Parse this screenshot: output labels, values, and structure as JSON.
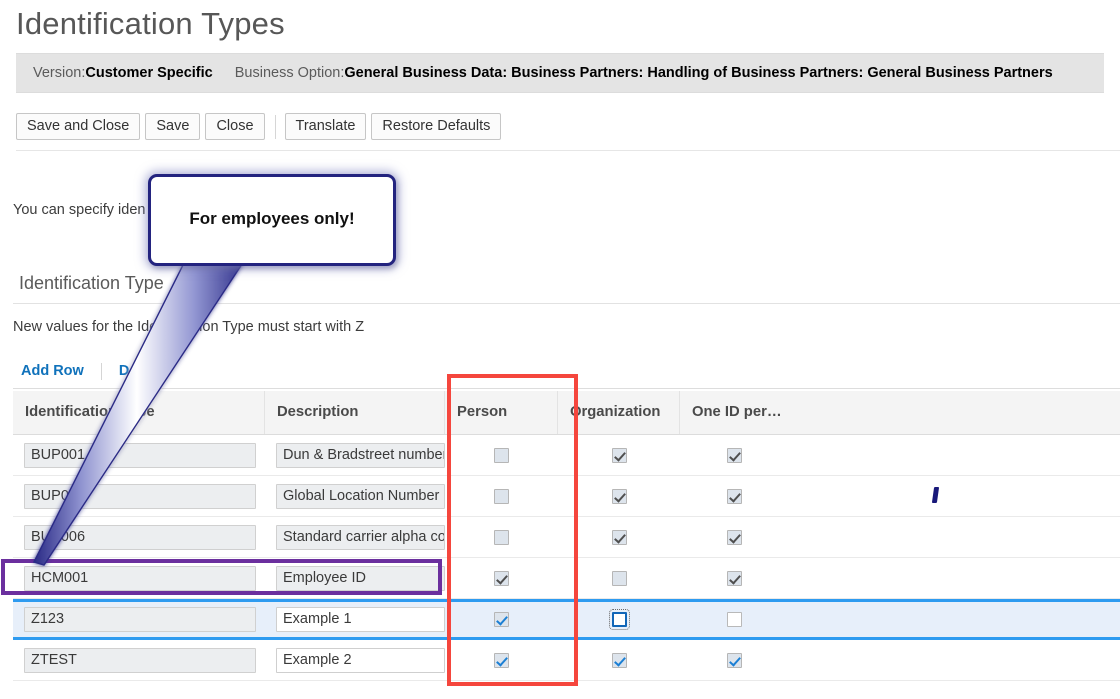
{
  "page": {
    "title": "Identification Types"
  },
  "info_bar": {
    "version_label": "Version:",
    "version_value": "Customer Specific",
    "business_option_label": "Business Option:",
    "business_option_value": "General Business Data: Business Partners: Handling of Business Partners: General Business Partners"
  },
  "toolbar": {
    "save_and_close": "Save and Close",
    "save": "Save",
    "close": "Close",
    "translate": "Translate",
    "restore_defaults": "Restore Defaults"
  },
  "intro": {
    "text": "You can specify iden"
  },
  "section": {
    "heading": "Identification Type",
    "hint": "New values for the Identification Type must start with Z"
  },
  "table_toolbar": {
    "add_row": "Add Row",
    "delete_row": "D"
  },
  "table": {
    "columns": [
      {
        "key": "identification_type",
        "label": "Identification Type"
      },
      {
        "key": "description",
        "label": "Description"
      },
      {
        "key": "person",
        "label": "Person"
      },
      {
        "key": "organization",
        "label": "Organization"
      },
      {
        "key": "one_id_per",
        "label": "One ID per…"
      }
    ],
    "rows": [
      {
        "identification_type": "BUP001",
        "description": "Dun & Bradstreet number",
        "person": "unchecked",
        "organization": "checked",
        "one_id_per": "checked",
        "editable": false,
        "state": "normal"
      },
      {
        "identification_type": "BUP0",
        "description": "Global Location Number",
        "person": "unchecked",
        "organization": "checked",
        "one_id_per": "checked",
        "editable": false,
        "state": "normal"
      },
      {
        "identification_type": "BUP006",
        "description": "Standard carrier alpha co",
        "person": "unchecked",
        "organization": "checked",
        "one_id_per": "checked",
        "editable": false,
        "state": "normal"
      },
      {
        "identification_type": "HCM001",
        "description": "Employee ID",
        "person": "checked",
        "organization": "unchecked",
        "one_id_per": "checked",
        "editable": false,
        "state": "highlighted"
      },
      {
        "identification_type": "Z123",
        "description": "Example 1",
        "person": "checked-blue",
        "organization": "focused-empty",
        "one_id_per": "unchecked-white",
        "editable": true,
        "state": "selected"
      },
      {
        "identification_type": "ZTEST",
        "description": "Example 2",
        "person": "checked-blue",
        "organization": "checked-blue",
        "one_id_per": "checked-blue",
        "editable": true,
        "state": "normal"
      }
    ]
  },
  "annotations": {
    "callout_text": "For employees only!",
    "red_box_target": "Person column",
    "purple_box_target": "HCM001 Employee ID row",
    "colors": {
      "callout_border": "#23237f",
      "red_box": "#f5463d",
      "purple_box": "#6b2f9e",
      "selection_blue": "#2e9bf0",
      "link_blue": "#1072bb"
    }
  }
}
